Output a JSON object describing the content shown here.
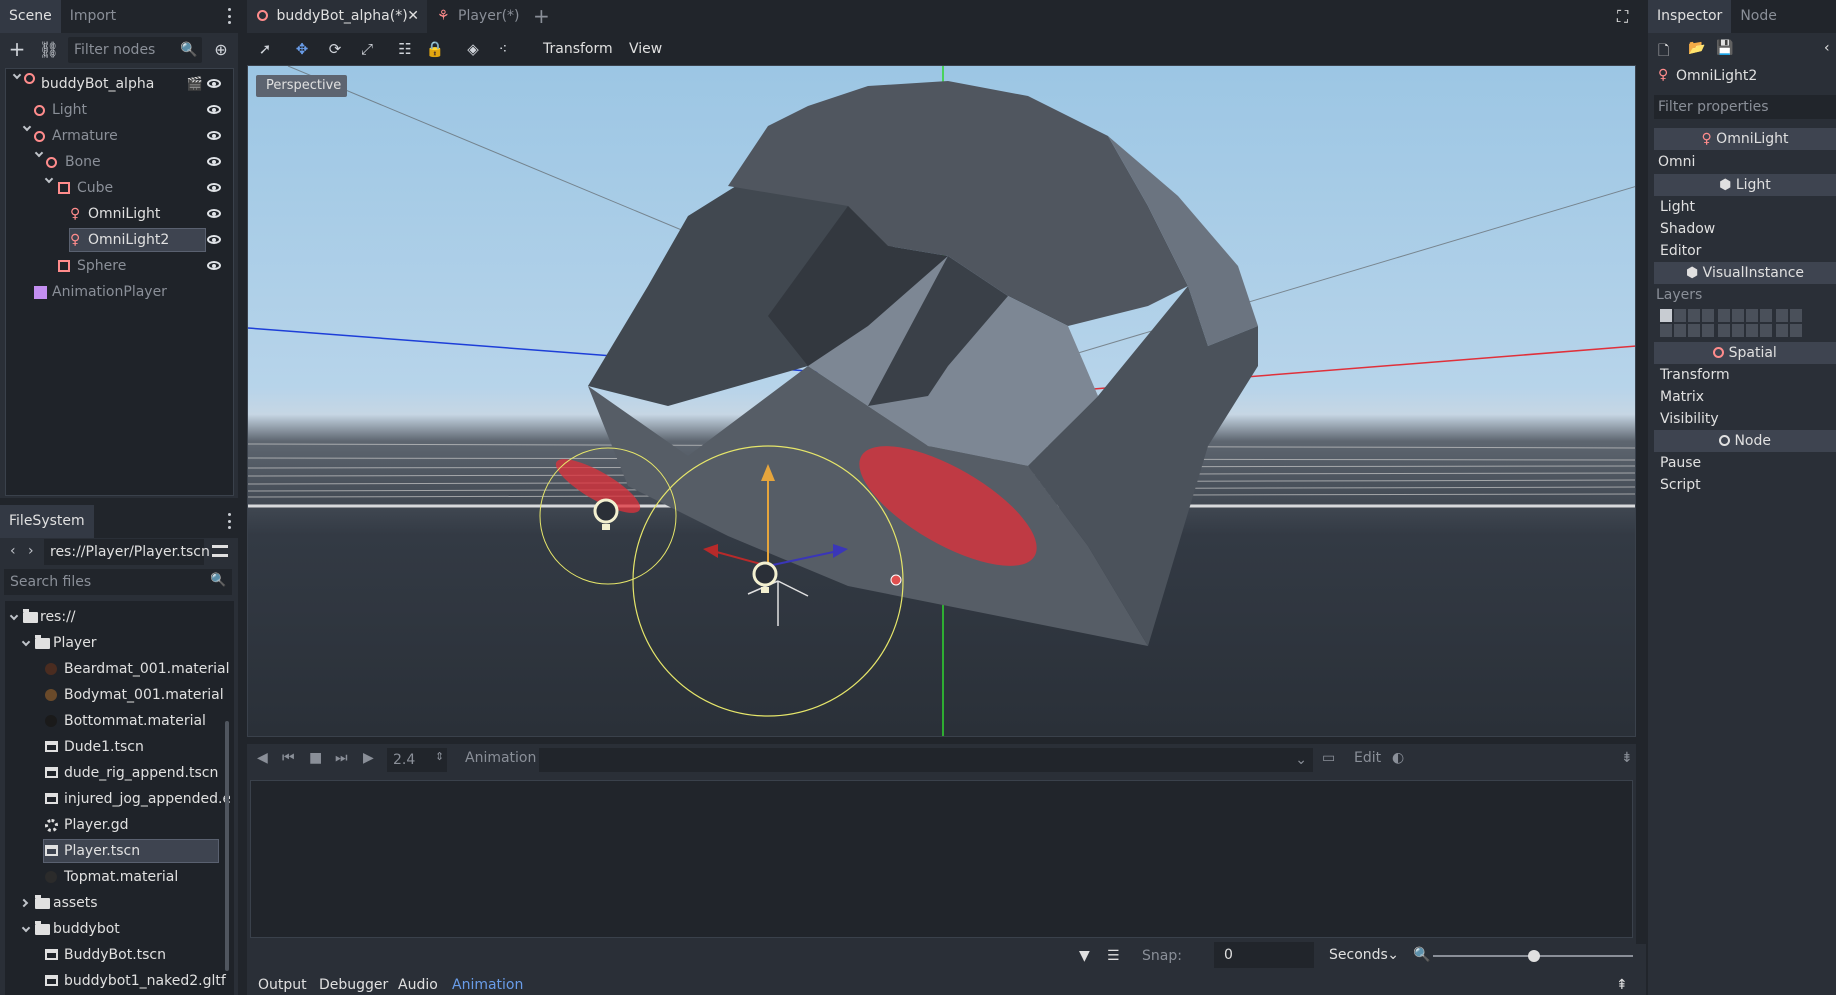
{
  "scene_dock": {
    "tabs": [
      "Scene",
      "Import"
    ],
    "filter_placeholder": "Filter nodes",
    "nodes": [
      {
        "label": "buddyBot_alpha"
      },
      {
        "label": "Light"
      },
      {
        "label": "Armature"
      },
      {
        "label": "Bone"
      },
      {
        "label": "Cube"
      },
      {
        "label": "OmniLight"
      },
      {
        "label": "OmniLight2"
      },
      {
        "label": "Sphere"
      },
      {
        "label": "AnimationPlayer"
      }
    ]
  },
  "filesystem": {
    "title": "FileSystem",
    "path": "res://Player/Player.tscn",
    "search_placeholder": "Search files",
    "items": [
      {
        "label": "res://"
      },
      {
        "label": "Player"
      },
      {
        "label": "Beardmat_001.material"
      },
      {
        "label": "Bodymat_001.material"
      },
      {
        "label": "Bottommat.material"
      },
      {
        "label": "Dude1.tscn"
      },
      {
        "label": "dude_rig_append.tscn"
      },
      {
        "label": "injured_jog_appended.e"
      },
      {
        "label": "Player.gd"
      },
      {
        "label": "Player.tscn"
      },
      {
        "label": "Topmat.material"
      },
      {
        "label": "assets"
      },
      {
        "label": "buddybot"
      },
      {
        "label": "BuddyBot.tscn"
      },
      {
        "label": "buddybot1_naked2.gltf"
      }
    ]
  },
  "editor": {
    "tabs": [
      "buddyBot_alpha(*)",
      "Player(*)"
    ],
    "menus": {
      "transform": "Transform",
      "view": "View"
    },
    "viewport_label": "Perspective"
  },
  "animation": {
    "time_value": "2.4",
    "animation_label": "Animation",
    "edit_label": "Edit",
    "snap_label": "Snap:",
    "snap_value": "0",
    "unit": "Seconds"
  },
  "bottom_tabs": [
    "Output",
    "Debugger",
    "Audio",
    "Animation"
  ],
  "inspector": {
    "tabs": [
      "Inspector",
      "Node"
    ],
    "node_name": "OmniLight2",
    "filter_placeholder": "Filter properties",
    "sections": {
      "omnilight": "OmniLight",
      "omni": "Omni",
      "light": "Light",
      "light_prop": "Light",
      "shadow": "Shadow",
      "editor": "Editor",
      "visual_instance": "VisualInstance",
      "layers": "Layers",
      "spatial": "Spatial",
      "transform": "Transform",
      "matrix": "Matrix",
      "visibility": "Visibility",
      "node": "Node",
      "pause": "Pause",
      "script": "Script"
    }
  },
  "colors": {
    "accent": "#699ce8",
    "node_red": "#ff8c8c",
    "selection": "#3e4450"
  }
}
